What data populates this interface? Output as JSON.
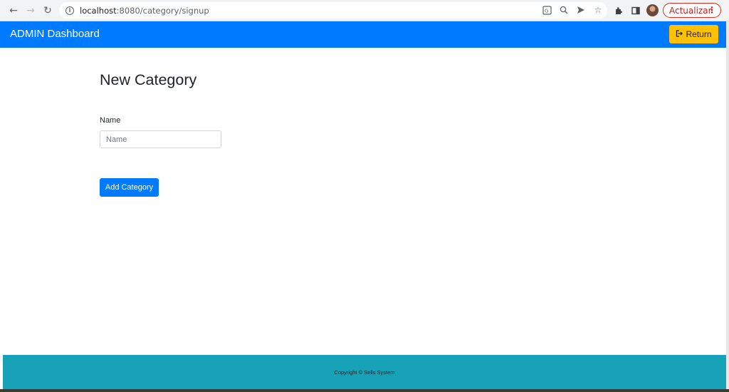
{
  "browser": {
    "url_host": "localhost",
    "url_rest": ":8080/category/signup",
    "update_label": "Actualizar"
  },
  "navbar": {
    "brand": "ADMIN Dashboard",
    "return_label": "Return"
  },
  "form": {
    "title": "New Category",
    "name_label": "Name",
    "name_placeholder": "Name",
    "name_value": "",
    "submit_label": "Add Category"
  },
  "footer": {
    "copyright": "Copyright © Sells System"
  },
  "colors": {
    "primary": "#007bff",
    "warning": "#ffc107",
    "footer": "#17a2b8"
  }
}
